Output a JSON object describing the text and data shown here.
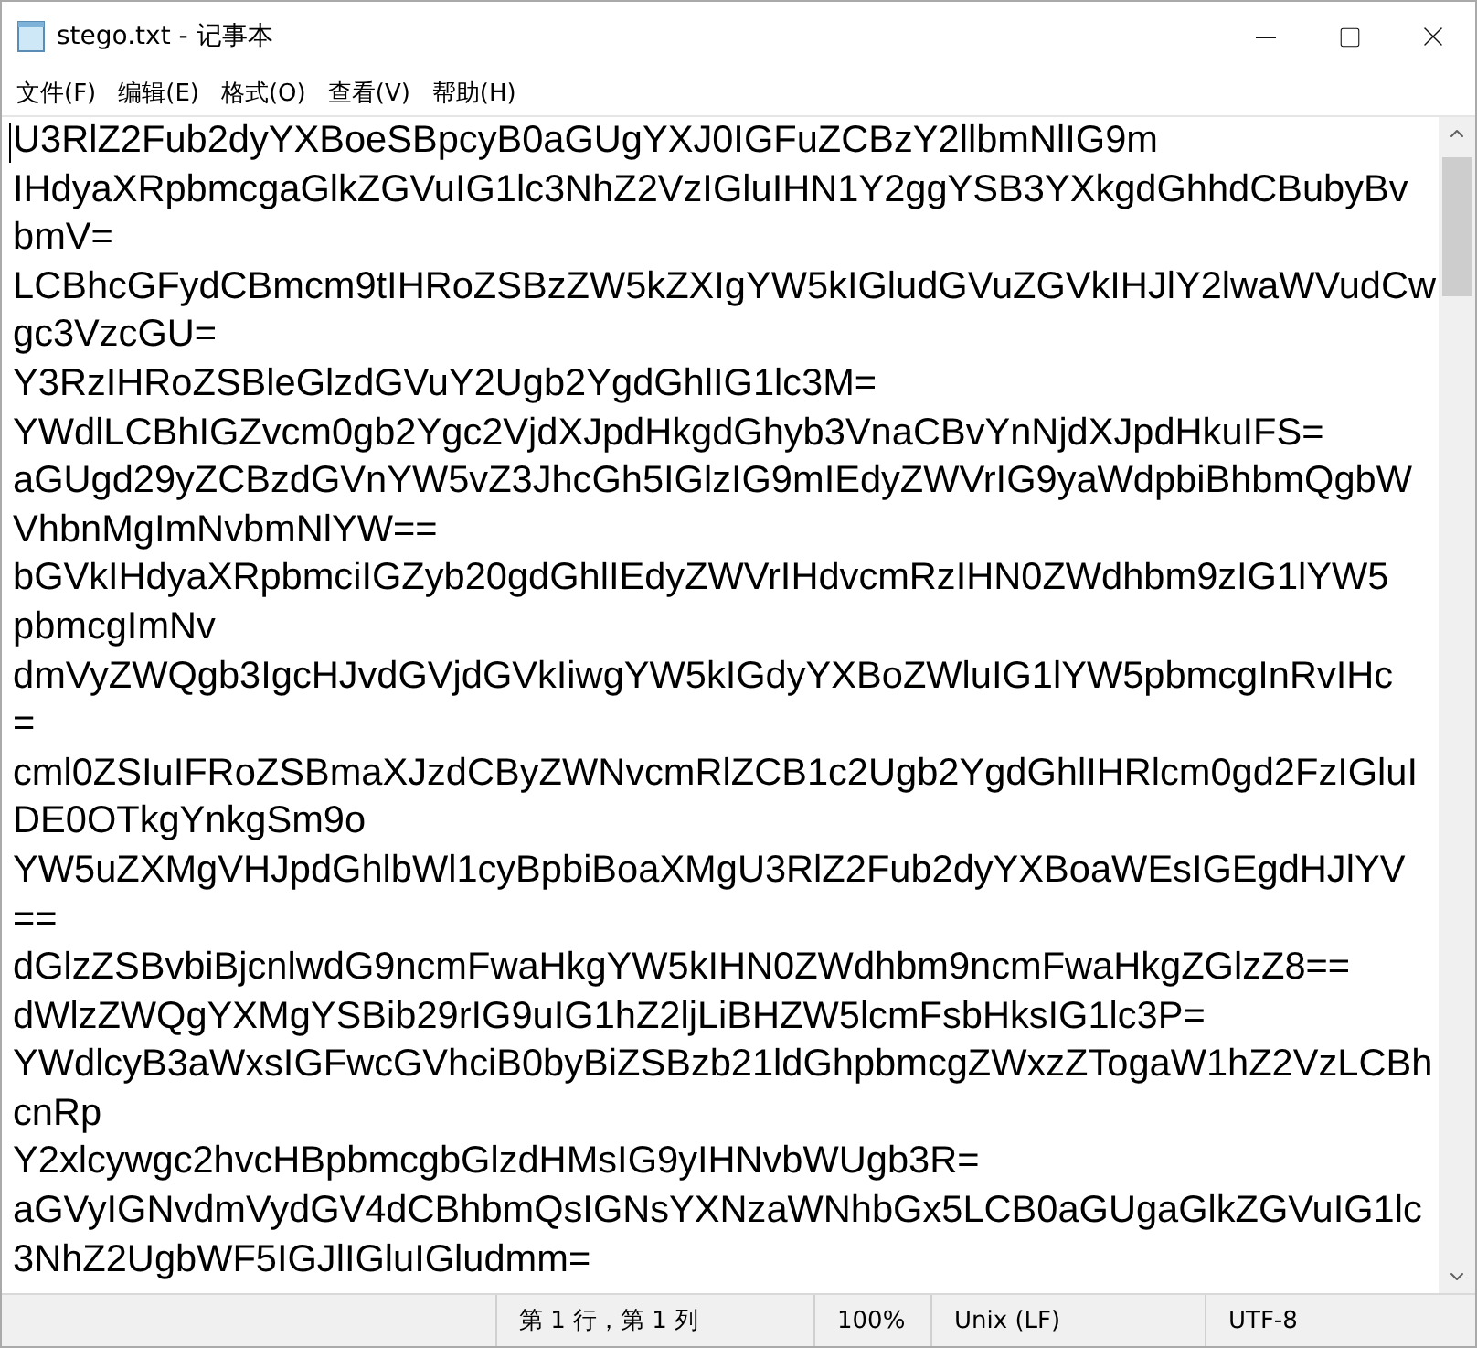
{
  "window": {
    "title": "stego.txt - 记事本"
  },
  "menu": [
    "文件(F)",
    "编辑(E)",
    "格式(O)",
    "查看(V)",
    "帮助(H)"
  ],
  "editor": {
    "lines": [
      "U3RlZ2Fub2dyYXBoeSBpcyB0aGUgYXJ0IGFuZCBzY2llbmNlIG9m",
      "IHdyaXRpbmcgaGlkZGVuIG1lc3NhZ2VzIGluIHN1Y2ggYSB3YXkgdGhhdCBubyBv",
      "bmV=",
      "LCBhcGFydCBmcm9tIHRoZSBzZW5kZXIgYW5kIGludGVuZGVkIHJlY2lwaWVudCw",
      "gc3VzcGU=",
      "Y3RzIHRoZSBleGlzdGVuY2Ugb2YgdGhlIG1lc3M=",
      "YWdlLCBhIGZvcm0gb2Ygc2VjdXJpdHkgdGhyb3VnaCBvYnNjdXJpdHkuIFS=",
      "aGUgd29yZCBzdGVnYW5vZ3JhcGh5IGlzIG9mIEdyZWVrIG9yaWdpbiBhbmQgbW",
      "VhbnMgImNvbmNlYW==",
      "bGVkIHdyaXRpbmciIGZyb20gdGhlIEdyZWVrIHdvcmRzIHN0ZWdhbm9zIG1lYW5",
      "pbmcgImNv",
      "dmVyZWQgb3IgcHJvdGVjdGVkIiwgYW5kIGdyYXBoZWluIG1lYW5pbmcgInRvIHc",
      "=",
      "cml0ZSIuIFRoZSBmaXJzdCByZWNvcmRlZCB1c2Ugb2YgdGhlIHRlcm0gd2FzIGluI",
      "DE0OTkgYnkgSm9o",
      "YW5uZXMgVHJpdGhlbWl1cyBpbiBoaXMgU3RlZ2Fub2dyYXBoaWEsIGEgdHJlYV",
      "==",
      "dGlzZSBvbiBjcnlwdG9ncmFwaHkgYW5kIHN0ZWdhbm9ncmFwaHkgZGlzZ8==",
      "dWlzZWQgYXMgYSBib29rIG9uIG1hZ2ljLiBHZW5lcmFsbHksIG1lc3P=",
      "YWdlcyB3aWxsIGFwcGVhciB0byBiZSBzb21ldGhpbmcgZWxzZTogaW1hZ2VzLCBh",
      "cnRp",
      "Y2xlcywgc2hvcHBpbmcgbGlzdHMsIG9yIHNvbWUgb3R=",
      "aGVyIGNvdmVydGV4dCBhbmQsIGNsYXNzaWNhbGx5LCB0aGUgaGlkZGVuIG1lc",
      "3NhZ2UgbWF5IGJlIGluIGludmm="
    ]
  },
  "status_bar": [
    "第 1 行，第 1 列",
    "100%",
    "Unix (LF)",
    "UTF-8"
  ]
}
